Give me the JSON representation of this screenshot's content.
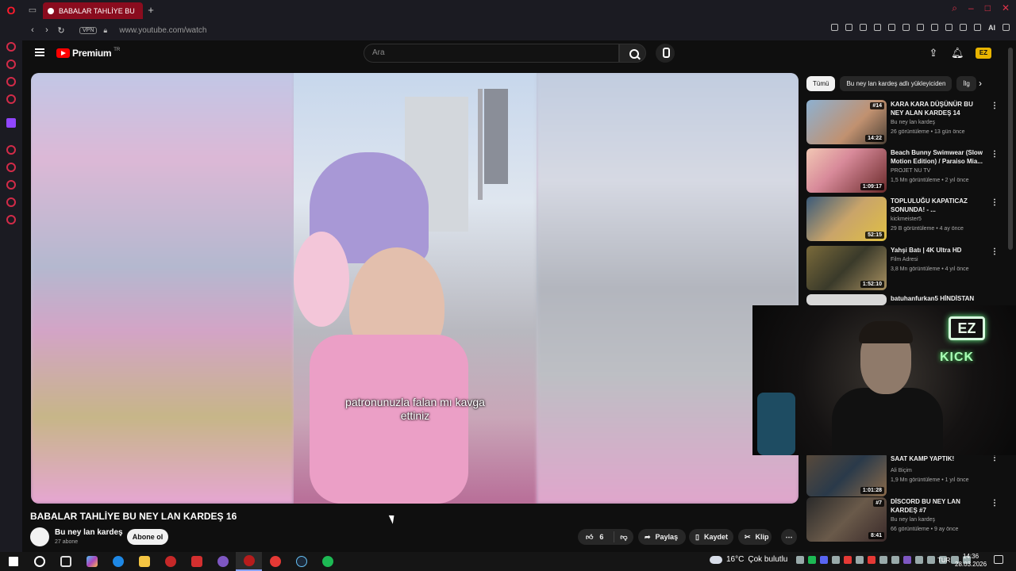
{
  "browser": {
    "tab_title": "BABALAR TAHLİYE BU",
    "new_tab": "+",
    "vpn_label": "VPN",
    "url": "www.youtube.com/watch",
    "ai_label": "AI"
  },
  "youtube": {
    "logo_text": "Premium",
    "logo_region": "TR",
    "search_placeholder": "Ara",
    "avatar_text": "EZ"
  },
  "video": {
    "subtitle_line1": "patronunuzla falan mı kavga",
    "subtitle_line2": "ettiniz",
    "title": "BABALAR TAHLİYE BU NEY LAN KARDEŞ 16",
    "channel_name": "Bu ney lan kardeş",
    "subscribers": "27 abone",
    "subscribe_label": "Abone ol",
    "likes": "6",
    "share_label": "Paylaş",
    "save_label": "Kaydet",
    "clip_label": "Klip",
    "more_label": "⋯"
  },
  "chips": [
    {
      "label": "Tümü"
    },
    {
      "label": "Bu ney lan kardeş adlı yükleyiciden"
    },
    {
      "label": "İlg"
    }
  ],
  "recommendations": [
    {
      "title": "KARA KARA DÜŞÜNÜR BU NEY ALAN KARDEŞ 14",
      "channel": "Bu ney lan kardeş",
      "meta": "26 görüntüleme • 13 gün önce",
      "duration": "14:22",
      "badge": "#14"
    },
    {
      "title": "Beach Bunny Swimwear (Slow Motion Edition) / Paraiso Mia...",
      "channel": "PROJET NU TV",
      "meta": "1,5 Mn görüntüleme • 2 yıl önce",
      "duration": "1:09:17",
      "badge": ""
    },
    {
      "title": "TOPLULUĞU KAPATICAZ SONUNDA! - ...",
      "channel": "kickmeister5",
      "meta": "29 B görüntüleme • 4 ay önce",
      "duration": "52:15",
      "badge": ""
    },
    {
      "title": "Yahşi Batı | 4K Ultra HD",
      "channel": "Film Adresi",
      "meta": "3,8 Mn görüntüleme • 4 yıl önce",
      "duration": "1:52:10",
      "badge": ""
    },
    {
      "title": "batuhanfurkan5 HİNDİSTAN",
      "channel": "",
      "meta": "",
      "duration": "",
      "badge": ""
    },
    {
      "title": "SAAT KAMP YAPTIK!",
      "channel": "Ali Biçim",
      "meta": "1,9 Mn görüntüleme • 1 yıl önce",
      "duration": "1:01:28",
      "badge": ""
    },
    {
      "title": "DİSCORD BU NEY LAN KARDEŞ #7",
      "channel": "Bu ney lan kardeş",
      "meta": "66 görüntüleme • 9 ay önce",
      "duration": "8:41",
      "badge": "#7"
    }
  ],
  "overlay": {
    "logo": "EZ",
    "platform": "KICK"
  },
  "taskbar": {
    "temperature": "16°C",
    "weather": "Çok bulutlu",
    "language": "TUR",
    "time": "14:36",
    "date": "28.03.2026"
  },
  "colors": {
    "yt_red": "#ff0000",
    "opera_red": "#ff1b2d",
    "tab_active": "#8a0c1e",
    "page_bg": "#0f0f0f"
  }
}
